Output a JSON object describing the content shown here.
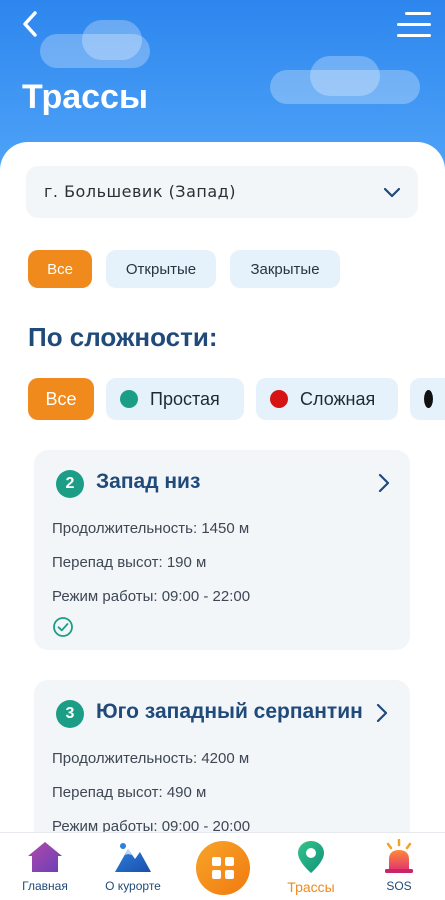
{
  "header": {
    "title": "Трассы"
  },
  "location": {
    "selected": "г. Большевик  (Запад)"
  },
  "status_filters": [
    {
      "label": "Все",
      "active": true
    },
    {
      "label": "Открытые",
      "active": false
    },
    {
      "label": "Закрытые",
      "active": false
    }
  ],
  "difficulty": {
    "heading": "По сложности:",
    "chips": [
      {
        "label": "Все",
        "active": true
      },
      {
        "label": "Простая",
        "color": "#1c9e86"
      },
      {
        "label": "Сложная",
        "color": "#d61414"
      },
      {
        "label": "",
        "color": "#111111"
      }
    ]
  },
  "trails": [
    {
      "number": "2",
      "name": "Запад низ",
      "length": "Продолжительность: 1450 м",
      "drop": "Перепад высот: 190 м",
      "hours": "Режим работы: 09:00 - 22:00",
      "status_icon": "check-circle-icon"
    },
    {
      "number": "3",
      "name": "Юго западный серпантин",
      "length": "Продолжительность: 4200 м",
      "drop": "Перепад высот: 490 м",
      "hours": "Режим работы: 09:00 - 20:00"
    }
  ],
  "bottom_nav": {
    "items": [
      {
        "label": "Главная",
        "icon": "home-icon"
      },
      {
        "label": "О курорте",
        "icon": "mountain-icon"
      },
      {
        "label": "",
        "icon": "grid-icon"
      },
      {
        "label": "Трассы",
        "icon": "map-pin-icon",
        "active": true
      },
      {
        "label": "SOS",
        "icon": "siren-icon"
      }
    ]
  },
  "colors": {
    "accent": "#f08a1c",
    "primary": "#1f4a7a",
    "header_bg": "#2d86ee"
  }
}
